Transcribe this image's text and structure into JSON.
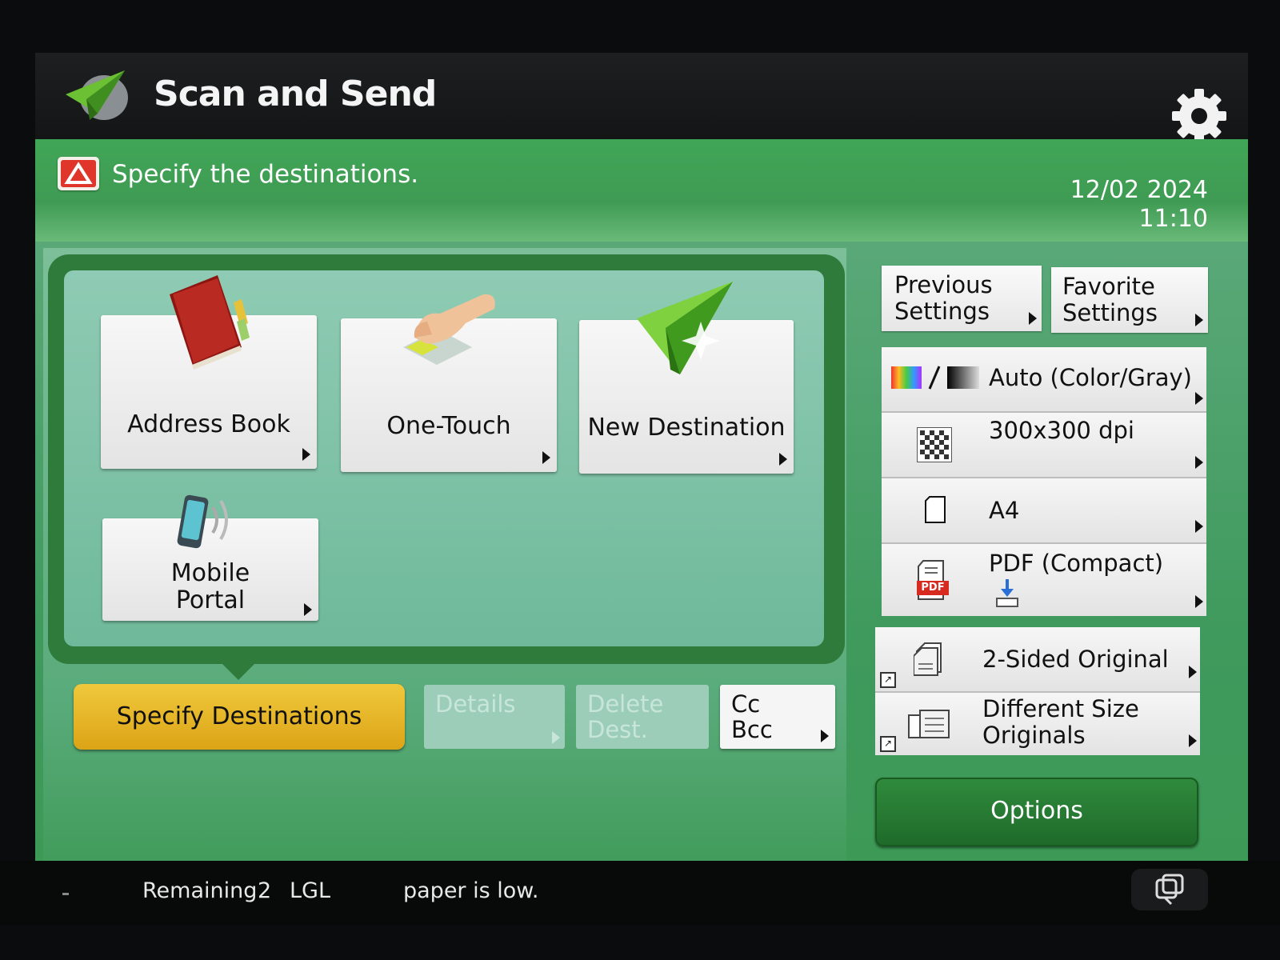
{
  "header": {
    "title": "Scan and Send"
  },
  "message": {
    "text": "Specify the destinations.",
    "date": "12/02 2024",
    "time": "11:10"
  },
  "destinations": {
    "address_book": "Address Book",
    "one_touch": "One-Touch",
    "new_destination": "New Destination",
    "mobile_portal_line1": "Mobile",
    "mobile_portal_line2": "Portal"
  },
  "actions": {
    "specify": "Specify Destinations",
    "details": "Details",
    "delete_line1": "Delete",
    "delete_line2": "Dest.",
    "cc_line1": "Cc",
    "cc_line2": "Bcc"
  },
  "sidebar": {
    "previous_line1": "Previous",
    "previous_line2": "Settings",
    "favorite_line1": "Favorite",
    "favorite_line2": "Settings",
    "color_mode": "Auto (Color/Gray)",
    "resolution": "300x300 dpi",
    "paper_size": "A4",
    "file_format": "PDF (Compact)",
    "pdf_badge": "PDF",
    "two_sided": "2-Sided Original",
    "diff_size_line1": "Different Size",
    "diff_size_line2": "Originals",
    "options": "Options"
  },
  "status": {
    "remaining_label": "Remaining",
    "count": "2",
    "paper": "LGL",
    "message": "paper is low."
  },
  "colors": {
    "accent_green": "#40a657",
    "specify_yellow": "#e8b82a",
    "options_green": "#25773a"
  }
}
